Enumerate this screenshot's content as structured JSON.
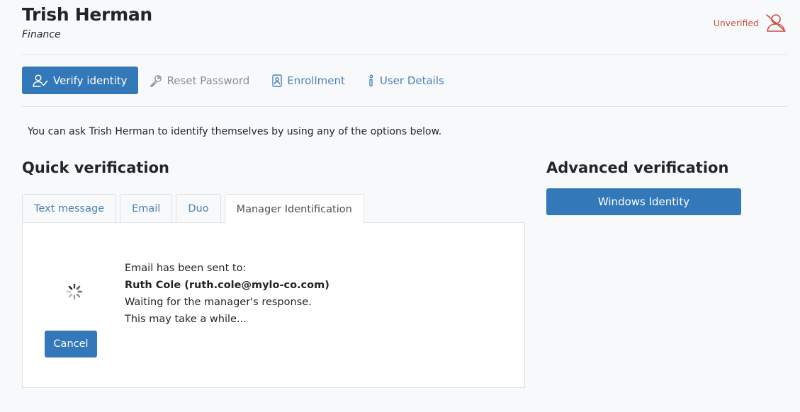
{
  "user": {
    "name": "Trish Herman",
    "department": "Finance",
    "status": "Unverified",
    "status_icon": "user-slash-icon",
    "status_color": "#c8504a"
  },
  "actions": [
    {
      "label": "Verify identity",
      "icon": "user-check-icon",
      "state": "active"
    },
    {
      "label": "Reset Password",
      "icon": "key-icon",
      "state": "disabled"
    },
    {
      "label": "Enrollment",
      "icon": "id-card-icon",
      "state": "normal"
    },
    {
      "label": "User Details",
      "icon": "info-icon",
      "state": "normal"
    }
  ],
  "intro": "You can ask Trish Herman to identify themselves by using any of the options below.",
  "quick": {
    "title": "Quick verification",
    "tabs": [
      "Text message",
      "Email",
      "Duo",
      "Manager Identification"
    ],
    "active_tab": "Manager Identification",
    "message": {
      "line1": "Email has been sent to:",
      "line2": "Ruth Cole (ruth.cole@mylo-co.com)",
      "line3": "Waiting for the manager's response.",
      "line4": "This may take a while..."
    },
    "cancel_label": "Cancel"
  },
  "advanced": {
    "title": "Advanced verification",
    "button_label": "Windows Identity"
  },
  "colors": {
    "primary": "#3378b8",
    "link": "#4a83b8",
    "background": "#f8f9fa"
  }
}
